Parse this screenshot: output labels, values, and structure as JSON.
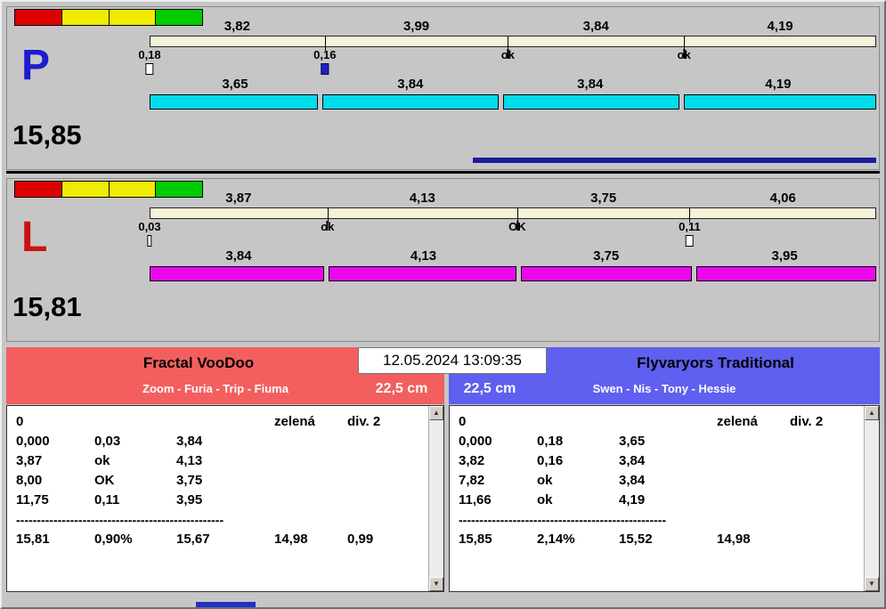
{
  "strip_colors": [
    "#dd0000",
    "#f0ec00",
    "#f0ec00",
    "#00cc00"
  ],
  "lanes": [
    {
      "letter": "P",
      "letter_color": "#1c1ccd",
      "total": "15,85",
      "top_values": [
        "3,82",
        "3,99",
        "3,84",
        "4,19"
      ],
      "marker_labels": [
        "0,18",
        "0,16",
        "ok",
        "ok"
      ],
      "marker_types": [
        "white-box",
        "blue-box",
        "tick",
        "tick"
      ],
      "bottom_values": [
        "3,65",
        "3,84",
        "3,84",
        "4,19"
      ],
      "bar_color": "#00dcea",
      "has_blue_line": true
    },
    {
      "letter": "L",
      "letter_color": "#cc1111",
      "total": "15,81",
      "top_values": [
        "3,87",
        "4,13",
        "3,75",
        "4,06"
      ],
      "marker_labels": [
        "0,03",
        "ok",
        "OK",
        "0,11"
      ],
      "marker_types": [
        "thin-box",
        "tick",
        "tick",
        "white-box"
      ],
      "bottom_values": [
        "3,84",
        "4,13",
        "3,75",
        "3,95"
      ],
      "bar_color": "#ea08ea",
      "has_blue_line": false
    }
  ],
  "center": {
    "datetime": "12.05.2024 13:09:35"
  },
  "teams": [
    {
      "name": "Fractal VooDoo",
      "members": "Zoom - Furia - Trip - Fiuma",
      "height": "22,5 cm",
      "color": "#f35f5f",
      "rows": [
        [
          "0",
          "",
          "",
          "zelená",
          "div. 2"
        ],
        [
          "0,000",
          "0,03",
          "3,84",
          "",
          ""
        ],
        [
          "3,87",
          "ok",
          "4,13",
          "",
          ""
        ],
        [
          "8,00",
          "OK",
          "3,75",
          "",
          ""
        ],
        [
          "11,75",
          "0,11",
          "3,95",
          "",
          ""
        ]
      ],
      "separator": "--------------------------------------------------",
      "summary": [
        "15,81",
        "0,90%",
        "15,67",
        "14,98",
        "0,99"
      ]
    },
    {
      "name": "Flyvaryors Traditional",
      "members": "Swen - Nis - Tony - Hessie",
      "height": "22,5 cm",
      "color": "#5f5ff0",
      "rows": [
        [
          "0",
          "",
          "",
          "zelená",
          "div. 2"
        ],
        [
          "0,000",
          "0,18",
          "3,65",
          "",
          ""
        ],
        [
          "3,82",
          "0,16",
          "3,84",
          "",
          ""
        ],
        [
          "7,82",
          "ok",
          "3,84",
          "",
          ""
        ],
        [
          "11,66",
          "ok",
          "4,19",
          "",
          ""
        ]
      ],
      "separator": "--------------------------------------------------",
      "summary": [
        "15,85",
        "2,14%",
        "15,52",
        "14,98",
        ""
      ]
    }
  ],
  "scrollbar": {
    "up": "▲",
    "down": "▼"
  }
}
